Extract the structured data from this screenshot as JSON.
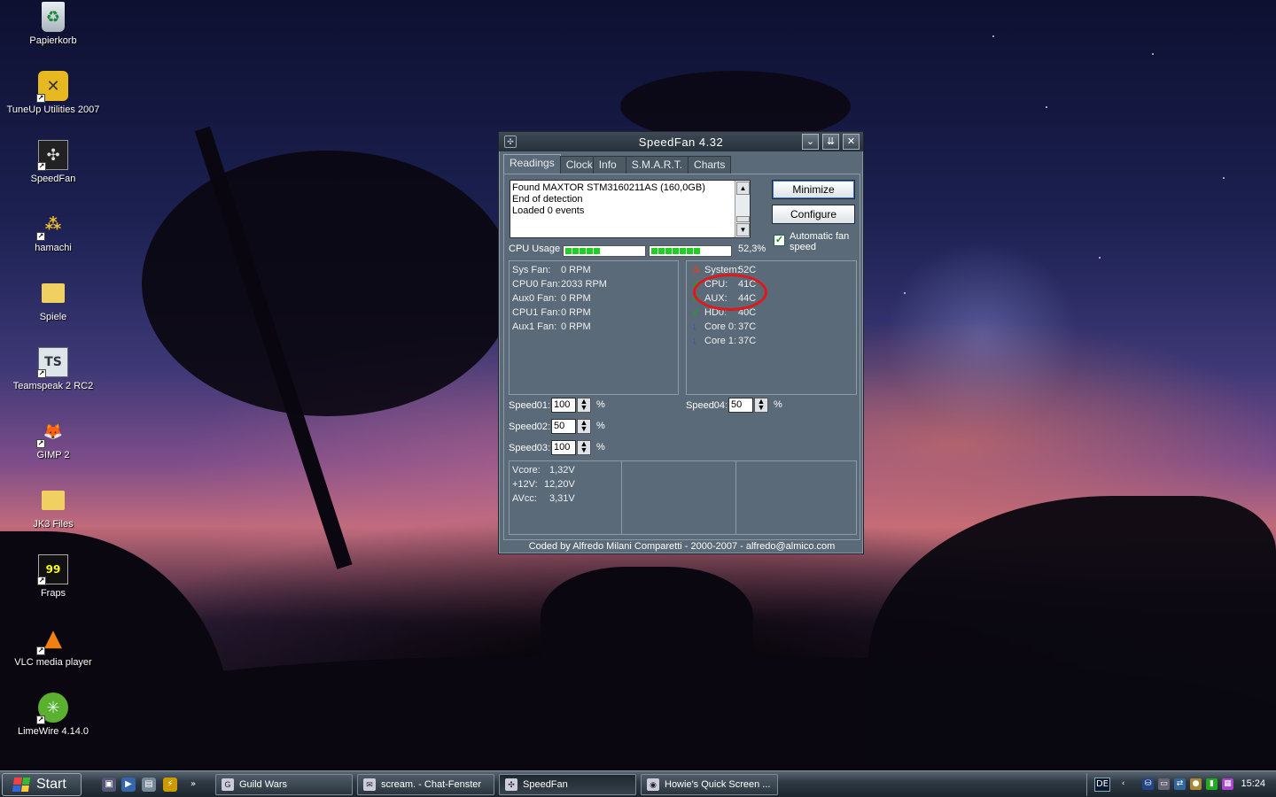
{
  "desktop": {
    "icons": [
      {
        "label": "Papierkorb",
        "icon": "recycle-bin-icon"
      },
      {
        "label": "TuneUp Utilities 2007",
        "icon": "tuneup-icon"
      },
      {
        "label": "SpeedFan",
        "icon": "speedfan-icon"
      },
      {
        "label": "hamachi",
        "icon": "hamachi-icon"
      },
      {
        "label": "Spiele",
        "icon": "folder-icon"
      },
      {
        "label": "Teamspeak 2 RC2",
        "icon": "teamspeak-icon"
      },
      {
        "label": "GIMP 2",
        "icon": "gimp-icon"
      },
      {
        "label": "JK3 Files",
        "icon": "folder-icon"
      },
      {
        "label": "Fraps",
        "icon": "fraps-icon"
      },
      {
        "label": "VLC media player",
        "icon": "vlc-icon"
      },
      {
        "label": "LimeWire 4.14.0",
        "icon": "limewire-icon"
      }
    ]
  },
  "speedfan": {
    "title": "SpeedFan 4.32",
    "tabs": [
      "Readings",
      "Clock",
      "Info",
      "S.M.A.R.T.",
      "Charts"
    ],
    "active_tab": "Readings",
    "log_lines": [
      "Found MAXTOR STM3160211AS (160,0GB)",
      "End of detection",
      "Loaded 0 events"
    ],
    "buttons": {
      "minimize": "Minimize",
      "configure": "Configure"
    },
    "auto_fan": {
      "label": "Automatic fan speed",
      "checked": true
    },
    "cpu_usage": {
      "label": "CPU Usage",
      "value": "52,3%",
      "core_levels": [
        0.5,
        0.7
      ]
    },
    "fans": [
      {
        "name": "Sys Fan:",
        "value": "0 RPM"
      },
      {
        "name": "CPU0 Fan:",
        "value": "2033 RPM"
      },
      {
        "name": "Aux0 Fan:",
        "value": "0 RPM"
      },
      {
        "name": "CPU1 Fan:",
        "value": "0 RPM"
      },
      {
        "name": "Aux1 Fan:",
        "value": "0 RPM"
      }
    ],
    "temps": [
      {
        "name": "System:",
        "value": "52C",
        "status": "hot-flame-icon"
      },
      {
        "name": "CPU:",
        "value": "41C",
        "status": "ok-check-icon"
      },
      {
        "name": "AUX:",
        "value": "44C",
        "status": "ok-check-icon"
      },
      {
        "name": "HD0:",
        "value": "40C",
        "status": "ok-check-icon"
      },
      {
        "name": "Core 0:",
        "value": "37C",
        "status": "down-arrow-icon"
      },
      {
        "name": "Core 1:",
        "value": "37C",
        "status": "down-arrow-icon"
      }
    ],
    "speeds": [
      {
        "label": "Speed01:",
        "value": "100",
        "unit": "%"
      },
      {
        "label": "Speed02:",
        "value": "50",
        "unit": "%"
      },
      {
        "label": "Speed03:",
        "value": "100",
        "unit": "%"
      },
      {
        "label": "Speed04:",
        "value": "50",
        "unit": "%"
      }
    ],
    "voltages": [
      {
        "name": "Vcore:",
        "value": "1,32V"
      },
      {
        "name": "+12V:",
        "value": "12,20V"
      },
      {
        "name": "AVcc:",
        "value": "3,31V"
      }
    ],
    "footer": "Coded by Alfredo Milani Comparetti - 2000-2007 - alfredo@almico.com",
    "colors": {
      "ok": "#20a020",
      "hot": "#e04020",
      "low": "#2050e0",
      "annotation": "#e01818"
    }
  },
  "taskbar": {
    "start_label": "Start",
    "overflow": "»",
    "tasks": [
      {
        "label": "Guild Wars",
        "active": false
      },
      {
        "label": "scream. - Chat-Fenster",
        "active": false
      },
      {
        "label": "SpeedFan",
        "active": true
      },
      {
        "label": "Howie's Quick Screen ...",
        "active": false
      }
    ],
    "language": "DE",
    "clock": "15:24"
  }
}
